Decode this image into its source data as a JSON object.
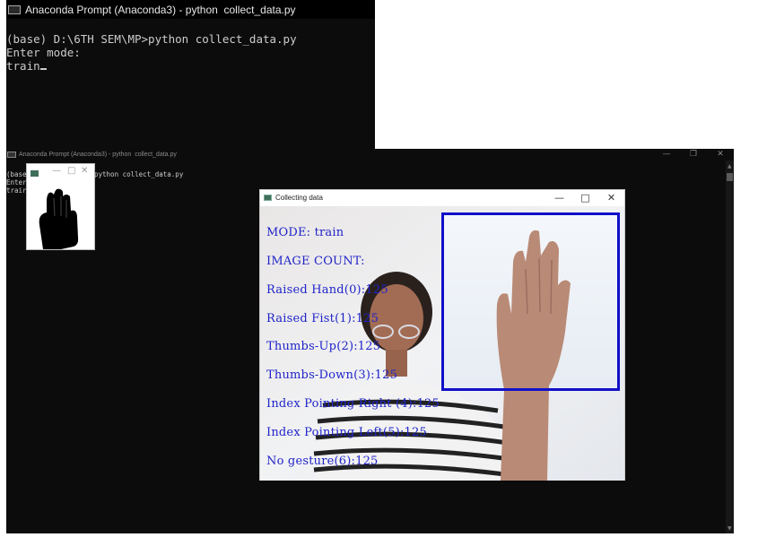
{
  "top_terminal": {
    "title": "Anaconda Prompt (Anaconda3) - python  collect_data.py",
    "lines": [
      "(base) D:\\6TH SEM\\MP>python collect_data.py",
      "Enter mode:",
      "train"
    ]
  },
  "bottom_terminal": {
    "title": "Anaconda Prompt (Anaconda3) - python  collect_data.py",
    "line1_prefix": "(base",
    "line1_rest": "python collect_data.py",
    "line2": "Enter",
    "line3": "trair",
    "controls": {
      "minimize": "—",
      "restore": "❐",
      "close": "✕"
    }
  },
  "mask_window": {
    "controls": {
      "minimize": "—",
      "maximize": "□",
      "close": "✕"
    }
  },
  "camera_window": {
    "title": "Collecting data",
    "controls": {
      "minimize": "—",
      "maximize": "□",
      "close": "✕"
    },
    "overlay": {
      "mode": "MODE: train",
      "image_count": "IMAGE COUNT:",
      "counts": [
        "Raised Hand(0):125",
        "Raised Fist(1):125",
        "Thumbs-Up(2):125",
        "Thumbs-Down(3):125",
        "Index Pointing Right (4):125",
        "Index Pointing Left(5):125",
        "No gesture(6):125"
      ]
    }
  },
  "colors": {
    "overlay_text": "#1f24c8",
    "roi_box": "#1010c8",
    "terminal_bg": "#0c0c0c"
  }
}
